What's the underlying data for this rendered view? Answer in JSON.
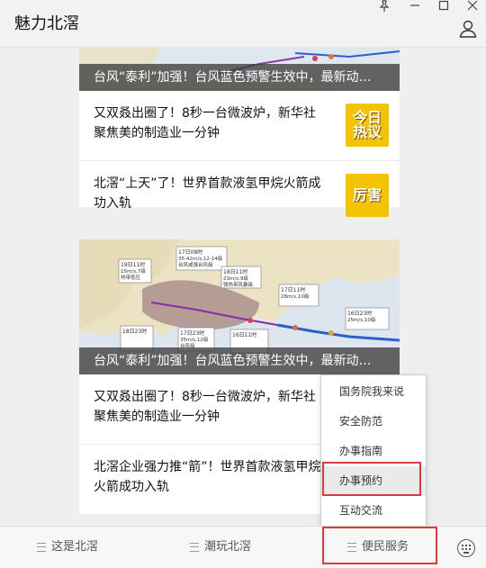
{
  "app": {
    "title": "魅力北滘"
  },
  "window_controls": [
    "pin-icon",
    "minimize-icon",
    "maximize-icon",
    "close-icon"
  ],
  "feed": {
    "block1": {
      "caption": "台风“泰利”加强！台风蓝色预警生效中，最新动…",
      "items": [
        {
          "text": "又双叒出圈了！8秒一台微波炉，新华社聚焦美的制造业一分钟",
          "thumb": "今日\n热议"
        },
        {
          "text": "北滘“上天”了！世界首款液氢甲烷火箭成功入轨",
          "thumb": "厉害"
        }
      ]
    },
    "block2": {
      "caption": "台风“泰利”加强！台风蓝色预警生效中，最新动…",
      "items": [
        {
          "text": "又双叒出圈了！8秒一台微波炉，新华社聚焦美的制造业一分钟"
        },
        {
          "text": "北滘企业强力推“箭”！世界首款液氢甲烷火箭成功入轨"
        }
      ]
    },
    "map_labels": [
      "17日08时",
      "35-42m/s,12-14级",
      "台风或强台风级",
      "19日11时",
      "15m/s,7级",
      "热带低压",
      "18日11时",
      "23m/s,9级",
      "强热带风暴级",
      "17日11时",
      "28m/s,10级",
      "16日23时",
      "25m/s,10级",
      "18日23时",
      "17日23时",
      "35m/s,12级",
      "台风级",
      "16日11时"
    ]
  },
  "menu": {
    "items": [
      "国务院我来说",
      "安全防范",
      "办事指南",
      "办事预约",
      "互动交流"
    ],
    "selected": "办事预约"
  },
  "bottom_nav": {
    "tabs": [
      "这是北滘",
      "潮玩北滘",
      "便民服务"
    ],
    "active": "便民服务",
    "keyboard_icon": "keyboard-icon"
  },
  "colors": {
    "highlight": "#e03a3a",
    "thumb_bg": "#f5c400",
    "caption_bg": "#3c3c3c"
  }
}
